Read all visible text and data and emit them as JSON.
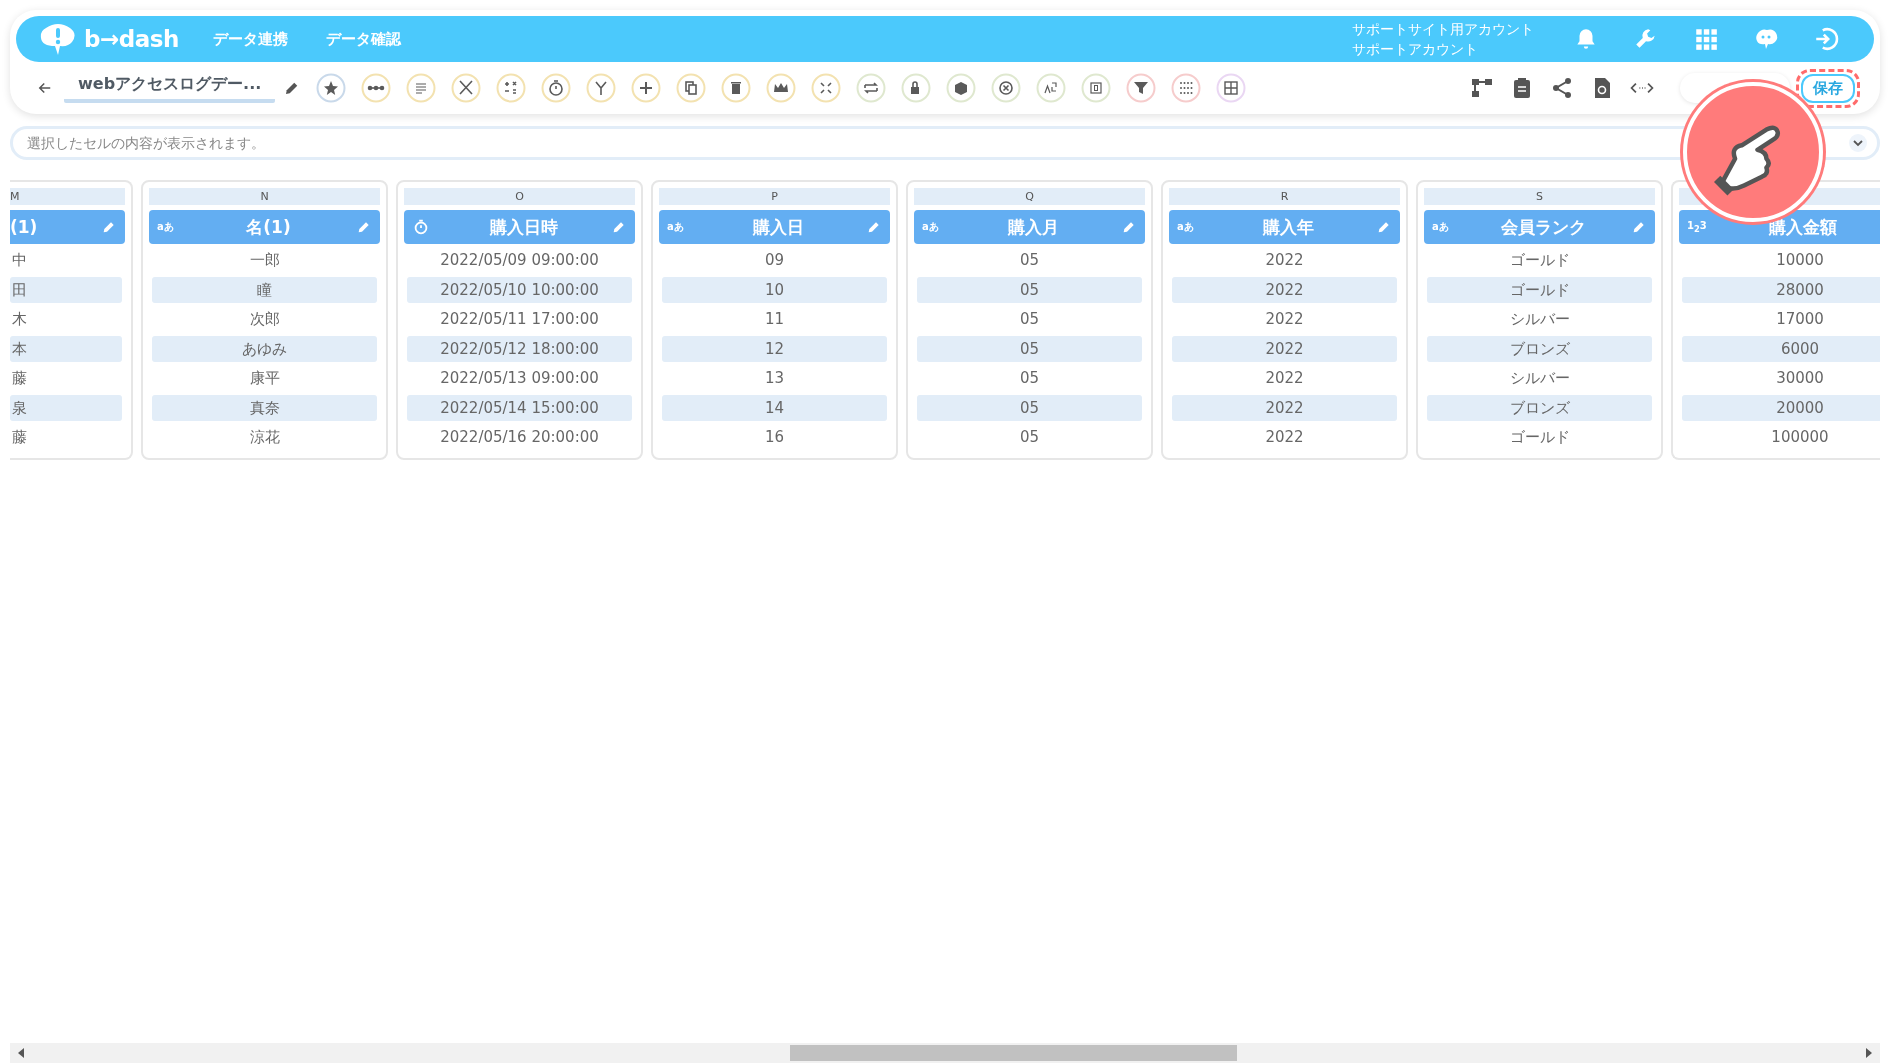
{
  "header": {
    "logo": "b→dash",
    "nav": [
      "データ連携",
      "データ確認"
    ],
    "account": [
      "サポートサイト用アカウント",
      "サポートアカウント"
    ]
  },
  "toolbar": {
    "title": "webアクセスログデー...",
    "save": "保存"
  },
  "cell_view": {
    "placeholder": "選択したセルの内容が表示されます。"
  },
  "columns": [
    {
      "letter": "M",
      "header": "(1)",
      "kind": "none",
      "edit": true,
      "cells": [
        "中",
        "田",
        "木",
        "本",
        "藤",
        "泉",
        "藤"
      ]
    },
    {
      "letter": "N",
      "header": "名(1)",
      "kind": "text",
      "badge": "aあ",
      "edit": true,
      "cells": [
        "一郎",
        "瞳",
        "次郎",
        "あゆみ",
        "康平",
        "真奈",
        "涼花"
      ]
    },
    {
      "letter": "O",
      "header": "購入日時",
      "kind": "datetime",
      "edit": true,
      "cells": [
        "2022/05/09 09:00:00",
        "2022/05/10 10:00:00",
        "2022/05/11 17:00:00",
        "2022/05/12 18:00:00",
        "2022/05/13 09:00:00",
        "2022/05/14 15:00:00",
        "2022/05/16 20:00:00"
      ]
    },
    {
      "letter": "P",
      "header": "購入日",
      "kind": "text",
      "badge": "aあ",
      "edit": true,
      "cells": [
        "09",
        "10",
        "11",
        "12",
        "13",
        "14",
        "16"
      ]
    },
    {
      "letter": "Q",
      "header": "購入月",
      "kind": "text",
      "badge": "aあ",
      "edit": true,
      "cells": [
        "05",
        "05",
        "05",
        "05",
        "05",
        "05",
        "05"
      ]
    },
    {
      "letter": "R",
      "header": "購入年",
      "kind": "text",
      "badge": "aあ",
      "edit": true,
      "cells": [
        "2022",
        "2022",
        "2022",
        "2022",
        "2022",
        "2022",
        "2022"
      ]
    },
    {
      "letter": "S",
      "header": "会員ランク",
      "kind": "text",
      "badge": "aあ",
      "edit": true,
      "cells": [
        "ゴールド",
        "ゴールド",
        "シルバー",
        "ブロンズ",
        "シルバー",
        "ブロンズ",
        "ゴールド"
      ]
    },
    {
      "header": "購入金額",
      "kind": "number",
      "badge": "1$_{2}$3",
      "edit": false,
      "cells": [
        "10000",
        "28000",
        "17000",
        "6000",
        "30000",
        "20000",
        "100000"
      ]
    }
  ]
}
